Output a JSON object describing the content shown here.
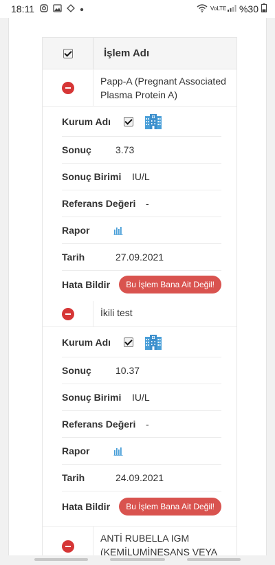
{
  "statusbar": {
    "time": "18:11",
    "network_label": "VoLTE",
    "battery": "%30",
    "icons": [
      "instagram-icon",
      "gallery-icon",
      "navigation-icon",
      "dot-icon",
      "wifi-icon",
      "signal-icon",
      "battery-icon"
    ]
  },
  "table": {
    "header_title": "İşlem Adı"
  },
  "procedures": [
    {
      "name": "Papp-A (Pregnant Associated Plasma Protein A)",
      "kurum_label": "Kurum Adı",
      "sonuc_label": "Sonuç",
      "sonuc_value": "3.73",
      "birim_label": "Sonuç Birimi",
      "birim_value": "IU/L",
      "referans_label": "Referans Değeri",
      "referans_value": "-",
      "rapor_label": "Rapor",
      "tarih_label": "Tarih",
      "tarih_value": "27.09.2021",
      "hata_label": "Hata Bildir",
      "hata_button": "Bu İşlem Bana Ait Değil!"
    },
    {
      "name": "İkili test",
      "kurum_label": "Kurum Adı",
      "sonuc_label": "Sonuç",
      "sonuc_value": "10.37",
      "birim_label": "Sonuç Birimi",
      "birim_value": "IU/L",
      "referans_label": "Referans Değeri",
      "referans_value": "-",
      "rapor_label": "Rapor",
      "tarih_label": "Tarih",
      "tarih_value": "24.09.2021",
      "hata_label": "Hata Bildir",
      "hata_button": "Bu İşlem Bana Ait Değil!"
    },
    {
      "name": "ANTİ RUBELLA IGM (KEMİLUMİNESANS VEYA"
    }
  ],
  "colors": {
    "accent_red": "#d9534f",
    "minus_red": "#d63636",
    "icon_blue": "#4a9fd8"
  }
}
